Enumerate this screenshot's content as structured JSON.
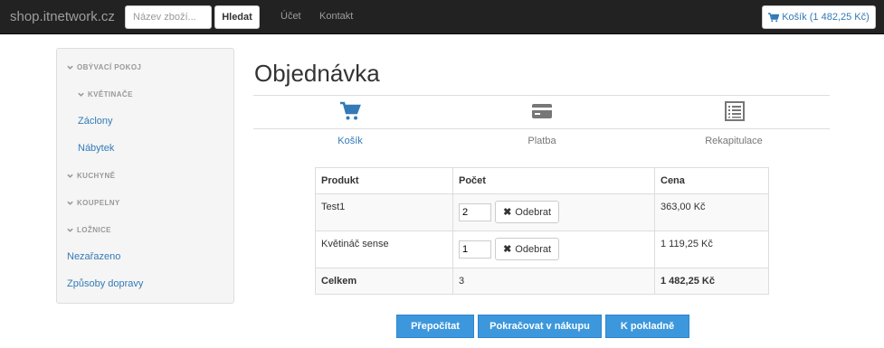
{
  "navbar": {
    "brand": "shop.itnetwork.cz",
    "search_placeholder": "Název zboží...",
    "search_button": "Hledat",
    "links": [
      "Účet",
      "Kontakt"
    ],
    "cart_label": "Košík (1 482,25 Kč)",
    "cart_icon": "shopping-cart-icon"
  },
  "sidebar": {
    "categories": [
      {
        "label": "OBÝVACÍ POKOJ",
        "type": "header",
        "icon": "chevron-down-icon"
      },
      {
        "label": "KVĚTINAČE",
        "type": "header",
        "icon": "chevron-down-icon"
      },
      {
        "label": "Záclony",
        "type": "link"
      },
      {
        "label": "Nábytek",
        "type": "link"
      },
      {
        "label": "KUCHYNĚ",
        "type": "header",
        "icon": "chevron-down-icon"
      },
      {
        "label": "KOUPELNY",
        "type": "header",
        "icon": "chevron-down-icon"
      },
      {
        "label": "LOŽNICE",
        "type": "header",
        "icon": "chevron-down-icon"
      },
      {
        "label": "Nezařazeno",
        "type": "link"
      },
      {
        "label": "Způsoby dopravy",
        "type": "link"
      }
    ]
  },
  "main": {
    "title": "Objednávka",
    "steps": [
      {
        "label": "Košík",
        "icon": "shopping-cart-icon",
        "active": true
      },
      {
        "label": "Platba",
        "icon": "credit-card-icon",
        "active": false
      },
      {
        "label": "Rekapitulace",
        "icon": "list-icon",
        "active": false
      }
    ],
    "table": {
      "headers": [
        "Produkt",
        "Počet",
        "Cena"
      ],
      "rows": [
        {
          "product": "Test1",
          "quantity": "2",
          "remove_label": "Odebrat",
          "price": "363,00 Kč"
        },
        {
          "product": "Květináč sense",
          "quantity": "1",
          "remove_label": "Odebrat",
          "price": "1 119,25 Kč"
        }
      ],
      "total": {
        "label": "Celkem",
        "count": "3",
        "price": "1 482,25 Kč"
      }
    },
    "buttons": [
      "Přepočítat",
      "Pokračovat v nákupu",
      "K pokladně"
    ]
  },
  "colors": {
    "navbar_bg": "#222222",
    "link": "#337ab7",
    "primary_button": "#3c97dc",
    "inactive_icon": "#777777"
  }
}
